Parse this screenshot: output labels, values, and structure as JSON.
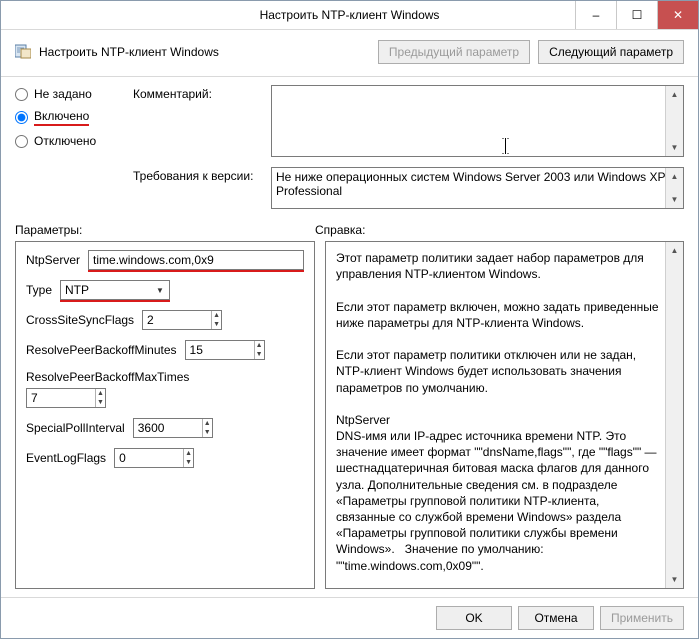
{
  "window": {
    "title": "Настроить NTP-клиент Windows"
  },
  "header": {
    "caption": "Настроить NTP-клиент Windows",
    "prev_button": "Предыдущий параметр",
    "next_button": "Следующий параметр"
  },
  "radios": {
    "not_configured": "Не задано",
    "enabled": "Включено",
    "disabled": "Отключено",
    "selected": "enabled"
  },
  "labels": {
    "comment": "Комментарий:",
    "requirements": "Требования к версии:",
    "params": "Параметры:",
    "help": "Справка:"
  },
  "comment_value": "",
  "requirements_text": "Не ниже операционных систем Windows Server 2003 или Windows XP Professional",
  "params": {
    "NtpServer": {
      "label": "NtpServer",
      "value": "time.windows.com,0x9"
    },
    "Type": {
      "label": "Type",
      "value": "NTP"
    },
    "CrossSiteSyncFlags": {
      "label": "CrossSiteSyncFlags",
      "value": "2"
    },
    "ResolvePeerBackoffMinutes": {
      "label": "ResolvePeerBackoffMinutes",
      "value": "15"
    },
    "ResolvePeerBackoffMaxTimes": {
      "label": "ResolvePeerBackoffMaxTimes",
      "value": "7"
    },
    "SpecialPollInterval": {
      "label": "SpecialPollInterval",
      "value": "3600"
    },
    "EventLogFlags": {
      "label": "EventLogFlags",
      "value": "0"
    }
  },
  "help_text": "Этот параметр политики задает набор параметров для управления NTP-клиентом Windows.\n\nЕсли этот параметр включен, можно задать приведенные ниже параметры для NTP-клиента Windows.\n\nЕсли этот параметр политики отключен или не задан, NTP-клиент Windows будет использовать значения параметров по умолчанию.\n\nNtpServer\nDNS-имя или IP-адрес источника времени NTP. Это значение имеет формат \"\"dnsName,flags\"\", где \"\"flags\"\" — шестнадцатеричная битовая маска флагов для данного узла. Дополнительные сведения см. в подразделе «Параметры групповой политики NTP-клиента, связанные со службой времени Windows» раздела «Параметры групповой политики службы времени Windows».   Значение по умолчанию: \"\"time.windows.com,0x09\"\".",
  "footer": {
    "ok": "OK",
    "cancel": "Отмена",
    "apply": "Применить"
  }
}
